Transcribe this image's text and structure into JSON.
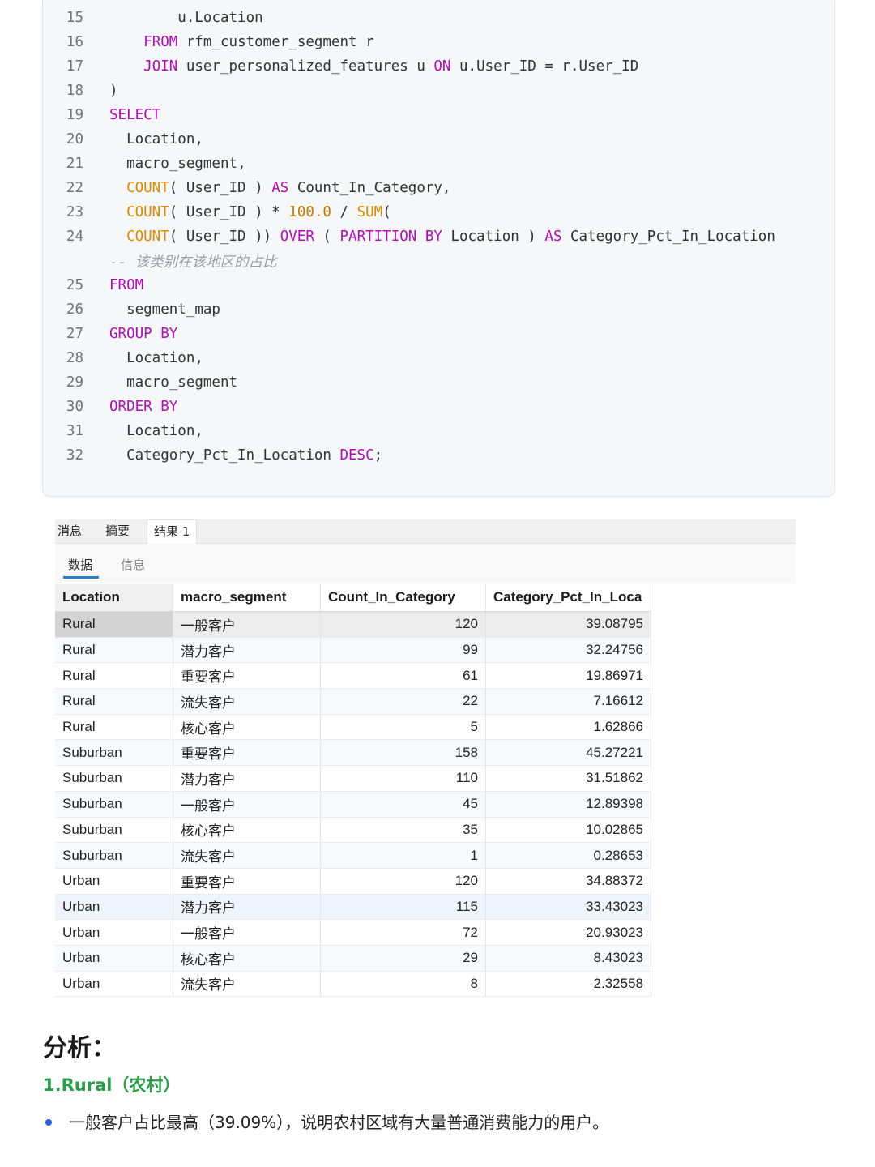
{
  "code": {
    "lines": [
      {
        "n": "15",
        "indent": "        ",
        "parts": [
          {
            "t": "u.Location",
            "c": ""
          }
        ]
      },
      {
        "n": "16",
        "indent": "    ",
        "parts": [
          {
            "t": "FROM",
            "c": "kw"
          },
          {
            "t": " rfm_customer_segment r",
            "c": ""
          }
        ]
      },
      {
        "n": "17",
        "indent": "    ",
        "parts": [
          {
            "t": "JOIN",
            "c": "kw"
          },
          {
            "t": " user_personalized_features u ",
            "c": ""
          },
          {
            "t": "ON",
            "c": "kw"
          },
          {
            "t": " u.User_ID = r.User_ID",
            "c": ""
          }
        ]
      },
      {
        "n": "18",
        "indent": "",
        "parts": [
          {
            "t": ")",
            "c": ""
          }
        ]
      },
      {
        "n": "19",
        "indent": "",
        "parts": [
          {
            "t": "SELECT",
            "c": "kw"
          }
        ]
      },
      {
        "n": "20",
        "indent": "  ",
        "parts": [
          {
            "t": "Location,",
            "c": ""
          }
        ]
      },
      {
        "n": "21",
        "indent": "  ",
        "parts": [
          {
            "t": "macro_segment,",
            "c": ""
          }
        ]
      },
      {
        "n": "22",
        "indent": "  ",
        "parts": [
          {
            "t": "COUNT",
            "c": "fn"
          },
          {
            "t": "( User_ID ) ",
            "c": ""
          },
          {
            "t": "AS",
            "c": "kw"
          },
          {
            "t": " Count_In_Category,",
            "c": ""
          }
        ]
      },
      {
        "n": "23",
        "indent": "  ",
        "parts": [
          {
            "t": "COUNT",
            "c": "fn"
          },
          {
            "t": "( User_ID ) * ",
            "c": ""
          },
          {
            "t": "100.0",
            "c": "num"
          },
          {
            "t": " / ",
            "c": ""
          },
          {
            "t": "SUM",
            "c": "fn"
          },
          {
            "t": "(",
            "c": ""
          }
        ]
      },
      {
        "n": "24",
        "indent": "  ",
        "parts": [
          {
            "t": "COUNT",
            "c": "fn"
          },
          {
            "t": "( User_ID )) ",
            "c": ""
          },
          {
            "t": "OVER",
            "c": "kw"
          },
          {
            "t": " ( ",
            "c": ""
          },
          {
            "t": "PARTITION BY",
            "c": "kw"
          },
          {
            "t": " Location ) ",
            "c": ""
          },
          {
            "t": "AS",
            "c": "kw"
          },
          {
            "t": " Category_Pct_In_Location",
            "c": ""
          }
        ]
      },
      {
        "n": "",
        "indent": "",
        "parts": [
          {
            "t": "-- 该类别在该地区的占比",
            "c": "cm"
          }
        ]
      },
      {
        "n": "25",
        "indent": "",
        "parts": [
          {
            "t": "FROM",
            "c": "kw"
          }
        ]
      },
      {
        "n": "26",
        "indent": "  ",
        "parts": [
          {
            "t": "segment_map",
            "c": ""
          }
        ]
      },
      {
        "n": "27",
        "indent": "",
        "parts": [
          {
            "t": "GROUP BY",
            "c": "kw"
          }
        ]
      },
      {
        "n": "28",
        "indent": "  ",
        "parts": [
          {
            "t": "Location,",
            "c": ""
          }
        ]
      },
      {
        "n": "29",
        "indent": "  ",
        "parts": [
          {
            "t": "macro_segment",
            "c": ""
          }
        ]
      },
      {
        "n": "30",
        "indent": "",
        "parts": [
          {
            "t": "ORDER BY",
            "c": "kw"
          }
        ]
      },
      {
        "n": "31",
        "indent": "  ",
        "parts": [
          {
            "t": "Location,",
            "c": ""
          }
        ]
      },
      {
        "n": "32",
        "indent": "  ",
        "parts": [
          {
            "t": "Category_Pct_In_Location ",
            "c": ""
          },
          {
            "t": "DESC",
            "c": "kw"
          },
          {
            "t": ";",
            "c": ""
          }
        ]
      }
    ]
  },
  "panel": {
    "tabs": [
      "消息",
      "摘要",
      "结果 1"
    ],
    "subtabs": [
      "数据",
      "信息"
    ]
  },
  "grid": {
    "columns": [
      "Location",
      "macro_segment",
      "Count_In_Category",
      "Category_Pct_In_Locа"
    ],
    "rows": [
      [
        "Rural",
        "一般客户",
        "120",
        "39.08795"
      ],
      [
        "Rural",
        "潜力客户",
        "99",
        "32.24756"
      ],
      [
        "Rural",
        "重要客户",
        "61",
        "19.86971"
      ],
      [
        "Rural",
        "流失客户",
        "22",
        "7.16612"
      ],
      [
        "Rural",
        "核心客户",
        "5",
        "1.62866"
      ],
      [
        "Suburban",
        "重要客户",
        "158",
        "45.27221"
      ],
      [
        "Suburban",
        "潜力客户",
        "110",
        "31.51862"
      ],
      [
        "Suburban",
        "一般客户",
        "45",
        "12.89398"
      ],
      [
        "Suburban",
        "核心客户",
        "35",
        "10.02865"
      ],
      [
        "Suburban",
        "流失客户",
        "1",
        "0.28653"
      ],
      [
        "Urban",
        "重要客户",
        "120",
        "34.88372"
      ],
      [
        "Urban",
        "潜力客户",
        "115",
        "33.43023"
      ],
      [
        "Urban",
        "一般客户",
        "72",
        "20.93023"
      ],
      [
        "Urban",
        "核心客户",
        "29",
        "8.43023"
      ],
      [
        "Urban",
        "流失客户",
        "8",
        "2.32558"
      ]
    ]
  },
  "analysis": {
    "title": "分析：",
    "subtitle": "1.Rural（农村）",
    "bullets": [
      "一般客户占比最高（39.09%），说明农村区域有大量普通消费能力的用户。"
    ]
  }
}
